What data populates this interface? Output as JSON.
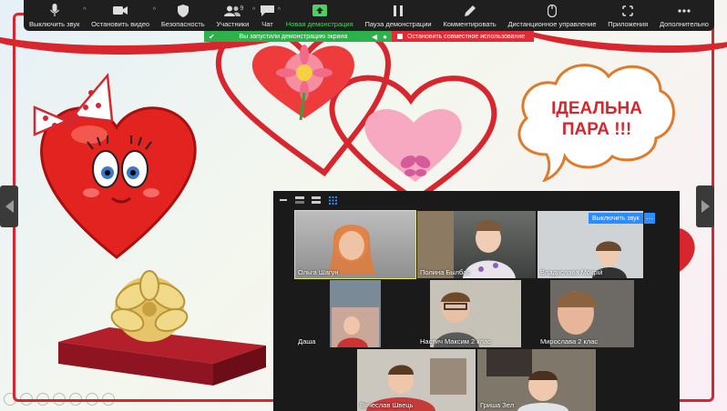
{
  "toolbar": {
    "mute": "Выключить звук",
    "video": "Остановить видео",
    "security": "Безопасность",
    "participants": "Участники",
    "participants_count": "9",
    "chat": "Чат",
    "new_share": "Новая демонстрация",
    "pause_share": "Пауза демонстрации",
    "annotate": "Комментировать",
    "remote_control": "Дистанционное управление",
    "apps": "Приложения",
    "more": "Дополнительно"
  },
  "banner": {
    "sharing": "Вы запустили демонстрацию экрана",
    "stop": "Остановить совместное использование"
  },
  "slide": {
    "cloud_line1": "ІДЕАЛЬНА",
    "cloud_line2": "ПАРА !!!"
  },
  "video_panel": {
    "unmute_label": "Выключить звук",
    "more_label": "···",
    "participants": [
      {
        "name": "Ольга Шагун"
      },
      {
        "name": "Полина Былбас"
      },
      {
        "name": "Владислава Мокрій"
      },
      {
        "name": "Даша"
      },
      {
        "name": "Настич Максим 2 клас"
      },
      {
        "name": "Мирослава 2 клас"
      },
      {
        "name": "Вячеслав Швець"
      },
      {
        "name": "Гриша Зел"
      }
    ]
  },
  "colors": {
    "toolbar_bg": "#1f1f1f",
    "share_green": "#2db14b",
    "stop_red": "#e02c37",
    "accent_blue": "#2d8cff",
    "slide_red": "#d8262e"
  }
}
